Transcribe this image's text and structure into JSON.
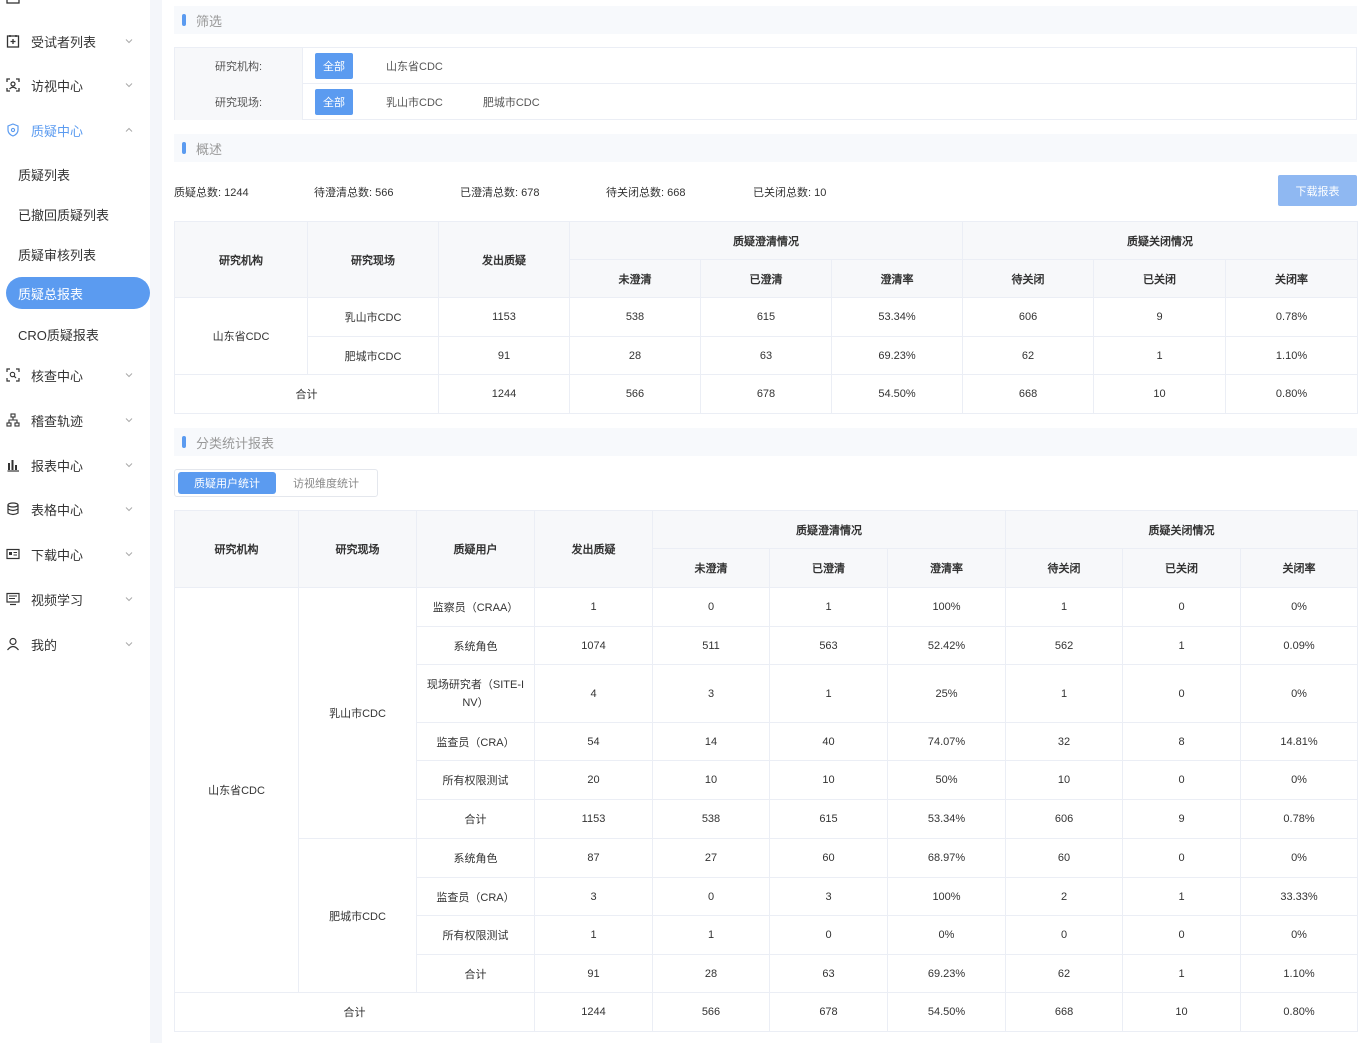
{
  "sidebar": {
    "items": [
      {
        "label": "受试者列表",
        "icon": "subject-plus-icon"
      },
      {
        "label": "访视中心",
        "icon": "visit-scan-icon"
      },
      {
        "label": "质疑中心",
        "icon": "shield-icon"
      },
      {
        "label": "核查中心",
        "icon": "search-frame-icon"
      },
      {
        "label": "稽查轨迹",
        "icon": "org-tree-icon"
      },
      {
        "label": "报表中心",
        "icon": "bar-chart-icon"
      },
      {
        "label": "表格中心",
        "icon": "database-icon"
      },
      {
        "label": "下载中心",
        "icon": "id-card-icon"
      },
      {
        "label": "视频学习",
        "icon": "monitor-icon"
      },
      {
        "label": "我的",
        "icon": "user-icon"
      }
    ],
    "sub_items": [
      "质疑列表",
      "已撤回质疑列表",
      "质疑审核列表",
      "质疑总报表",
      "CRO质疑报表"
    ]
  },
  "filter": {
    "section_title": "筛选",
    "rows": [
      {
        "label": "研究机构:",
        "all": "全部",
        "options": [
          "山东省CDC"
        ]
      },
      {
        "label": "研究现场:",
        "all": "全部",
        "options": [
          "乳山市CDC",
          "肥城市CDC"
        ]
      }
    ]
  },
  "overview": {
    "section_title": "概述",
    "stats": [
      "质疑总数: 1244",
      "待澄清总数: 566",
      "已澄清总数: 678",
      "待关闭总数: 668",
      "已关闭总数: 10"
    ],
    "download_label": "下载报表",
    "headers": {
      "org": "研究机构",
      "site": "研究现场",
      "issued": "发出质疑",
      "clarify_group": "质疑澄清情况",
      "close_group": "质疑关闭情况",
      "unclarified": "未澄清",
      "clarified": "已澄清",
      "clarify_rate": "澄清率",
      "pending_close": "待关闭",
      "closed": "已关闭",
      "close_rate": "关闭率"
    },
    "org_name": "山东省CDC",
    "rows": [
      [
        "乳山市CDC",
        "1153",
        "538",
        "615",
        "53.34%",
        "606",
        "9",
        "0.78%"
      ],
      [
        "肥城市CDC",
        "91",
        "28",
        "63",
        "69.23%",
        "62",
        "1",
        "1.10%"
      ]
    ],
    "total": [
      "合计",
      "1244",
      "566",
      "678",
      "54.50%",
      "668",
      "10",
      "0.80%"
    ]
  },
  "category": {
    "section_title": "分类统计报表",
    "tabs": [
      "质疑用户统计",
      "访视维度统计"
    ],
    "headers": {
      "org": "研究机构",
      "site": "研究现场",
      "user": "质疑用户",
      "issued": "发出质疑",
      "clarify_group": "质疑澄清情况",
      "close_group": "质疑关闭情况",
      "unclarified": "未澄清",
      "clarified": "已澄清",
      "clarify_rate": "澄清率",
      "pending_close": "待关闭",
      "closed": "已关闭",
      "close_rate": "关闭率"
    },
    "org_name": "山东省CDC",
    "sites": [
      {
        "name": "乳山市CDC",
        "rows": [
          [
            "监察员（CRAA）",
            "1",
            "0",
            "1",
            "100%",
            "1",
            "0",
            "0%"
          ],
          [
            "系统角色",
            "1074",
            "511",
            "563",
            "52.42%",
            "562",
            "1",
            "0.09%"
          ],
          [
            "现场研究者（SITE-INV）",
            "4",
            "3",
            "1",
            "25%",
            "1",
            "0",
            "0%"
          ],
          [
            "监查员（CRA）",
            "54",
            "14",
            "40",
            "74.07%",
            "32",
            "8",
            "14.81%"
          ],
          [
            "所有权限测试",
            "20",
            "10",
            "10",
            "50%",
            "10",
            "0",
            "0%"
          ],
          [
            "合计",
            "1153",
            "538",
            "615",
            "53.34%",
            "606",
            "9",
            "0.78%"
          ]
        ]
      },
      {
        "name": "肥城市CDC",
        "rows": [
          [
            "系统角色",
            "87",
            "27",
            "60",
            "68.97%",
            "60",
            "0",
            "0%"
          ],
          [
            "监查员（CRA）",
            "3",
            "0",
            "3",
            "100%",
            "2",
            "1",
            "33.33%"
          ],
          [
            "所有权限测试",
            "1",
            "1",
            "0",
            "0%",
            "0",
            "0",
            "0%"
          ],
          [
            "合计",
            "91",
            "28",
            "63",
            "69.23%",
            "62",
            "1",
            "1.10%"
          ]
        ]
      }
    ],
    "total": [
      "合计",
      "1244",
      "566",
      "678",
      "54.50%",
      "668",
      "10",
      "0.80%"
    ]
  },
  "colors": {
    "accent": "#5b9bf0",
    "accent_light": "#8fb8f2",
    "border": "#ebeef5",
    "header_bg": "#f7f8fa"
  }
}
